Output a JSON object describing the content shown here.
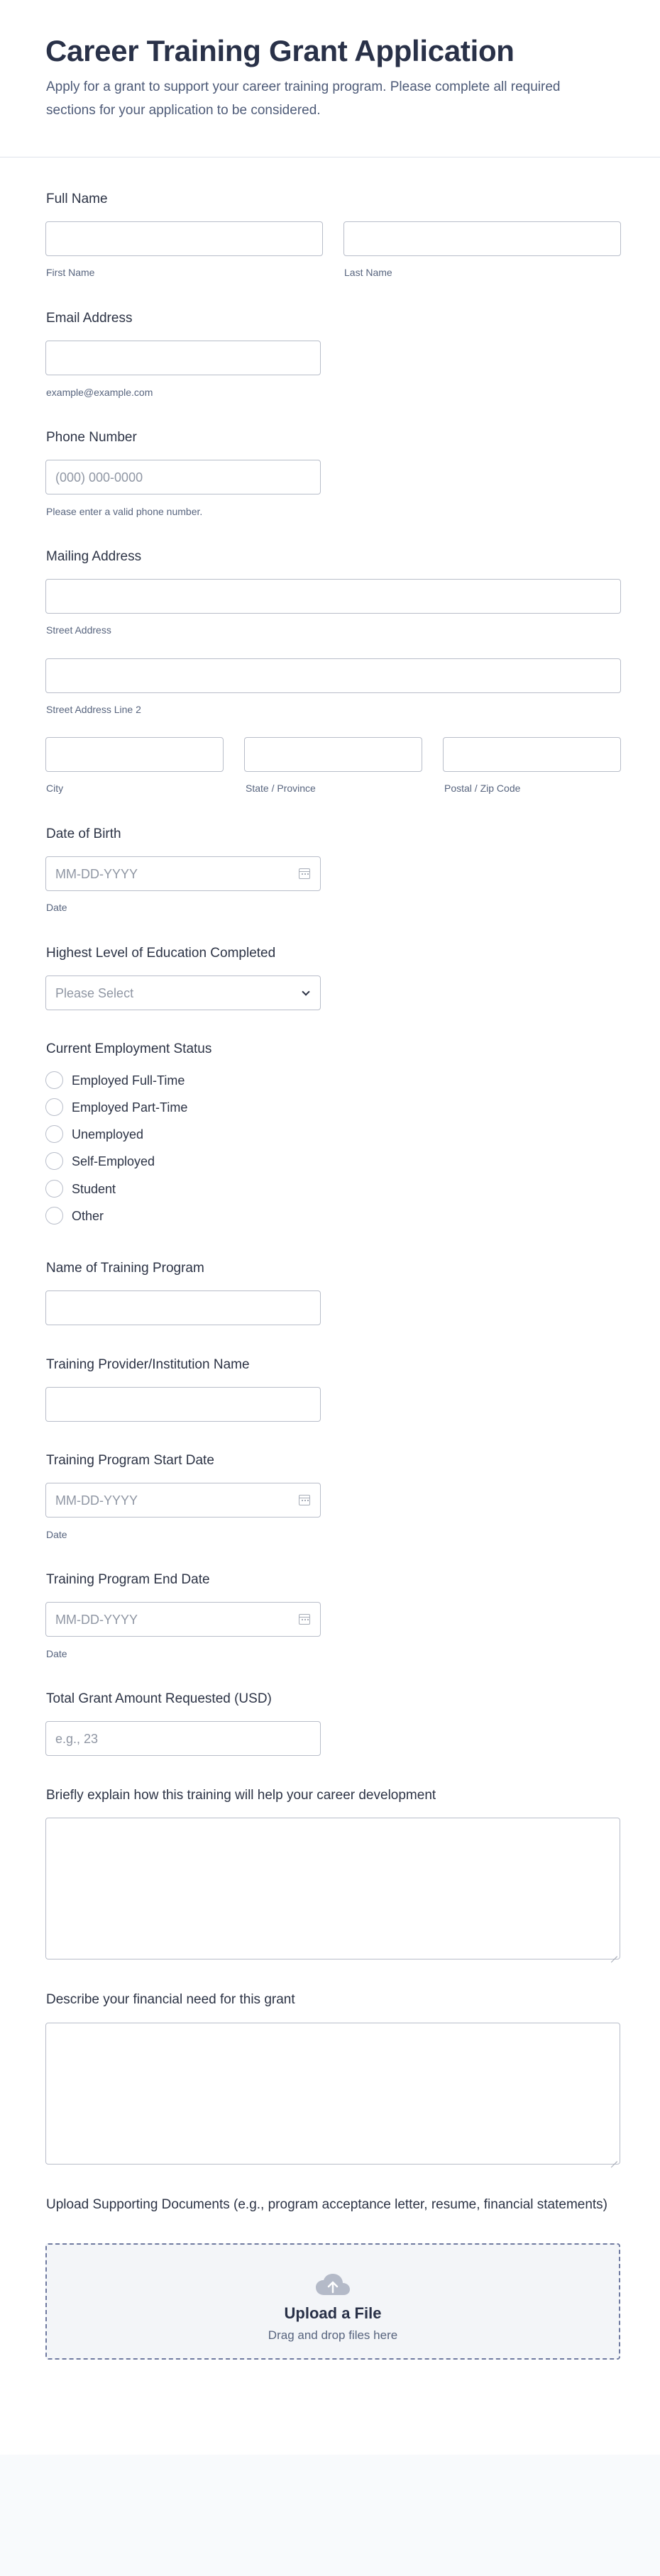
{
  "header": {
    "title": "Career Training Grant Application",
    "subtitle": "Apply for a grant to support your career training program. Please complete all required sections for your application to be considered."
  },
  "full_name": {
    "label": "Full Name",
    "first_sublabel": "First Name",
    "last_sublabel": "Last Name"
  },
  "email": {
    "label": "Email Address",
    "sublabel": "example@example.com"
  },
  "phone": {
    "label": "Phone Number",
    "placeholder": "(000) 000-0000",
    "sublabel": "Please enter a valid phone number."
  },
  "address": {
    "label": "Mailing Address",
    "street": "Street Address",
    "street2": "Street Address Line 2",
    "city": "City",
    "state": "State / Province",
    "zip": "Postal / Zip Code"
  },
  "dob": {
    "label": "Date of Birth",
    "placeholder": "MM-DD-YYYY",
    "sublabel": "Date"
  },
  "education": {
    "label": "Highest Level of Education Completed",
    "placeholder": "Please Select"
  },
  "employment": {
    "label": "Current Employment Status",
    "options": [
      "Employed Full-Time",
      "Employed Part-Time",
      "Unemployed",
      "Self-Employed",
      "Student",
      "Other"
    ]
  },
  "program_name": {
    "label": "Name of Training Program"
  },
  "provider": {
    "label": "Training Provider/Institution Name"
  },
  "start_date": {
    "label": "Training Program Start Date",
    "placeholder": "MM-DD-YYYY",
    "sublabel": "Date"
  },
  "end_date": {
    "label": "Training Program End Date",
    "placeholder": "MM-DD-YYYY",
    "sublabel": "Date"
  },
  "amount": {
    "label": "Total Grant Amount Requested (USD)",
    "placeholder": "e.g., 23"
  },
  "career_explain": {
    "label": "Briefly explain how this training will help your career development"
  },
  "financial_need": {
    "label": "Describe your financial need for this grant"
  },
  "upload": {
    "label": "Upload Supporting Documents (e.g., program acceptance letter, resume, financial statements)",
    "title": "Upload a File",
    "subtitle": "Drag and drop files here",
    "icon": "cloud-upload-icon"
  }
}
